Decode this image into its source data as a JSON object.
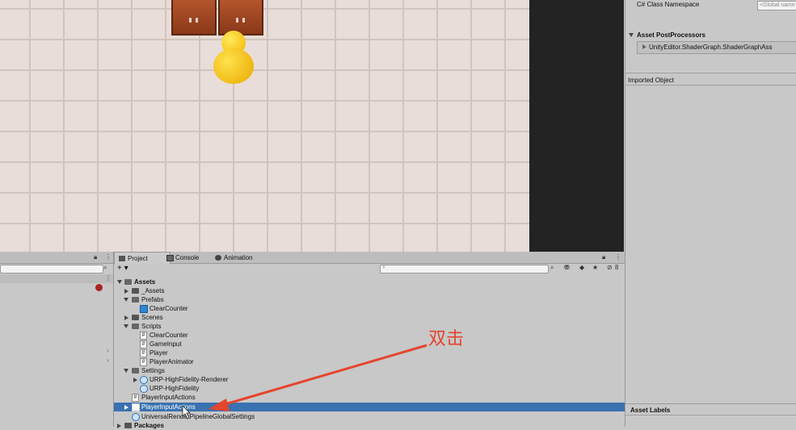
{
  "inspector": {
    "namespace_label": "C# Class Namespace",
    "namespace_placeholder": "<Global name",
    "postprocessors_header": "Asset PostProcessors",
    "postprocessor_item": "UnityEditor.ShaderGraph.ShaderGraphAss",
    "imported_object": "Imported Object",
    "asset_labels": "Asset Labels"
  },
  "project": {
    "tabs": [
      {
        "label": "Project"
      },
      {
        "label": "Console"
      },
      {
        "label": "Animation"
      }
    ],
    "add_label": "+ ▾",
    "hidden_count": "8",
    "tree": [
      {
        "label": "Assets"
      },
      {
        "label": "_Assets"
      },
      {
        "label": "Prefabs"
      },
      {
        "label": "ClearCounter"
      },
      {
        "label": "Scenes"
      },
      {
        "label": "Scripts"
      },
      {
        "label": "ClearCounter"
      },
      {
        "label": "GameInput"
      },
      {
        "label": "Player"
      },
      {
        "label": "PlayerAnimator"
      },
      {
        "label": "Settings"
      },
      {
        "label": "URP-HighFidelity-Renderer"
      },
      {
        "label": "URP-HighFidelity"
      },
      {
        "label": "PlayerInputActions"
      },
      {
        "label": "PlayerInputActions"
      },
      {
        "label": "UniversalRenderPipelineGlobalSettings"
      },
      {
        "label": "Packages"
      }
    ]
  },
  "annotation": {
    "text": "双击",
    "color": "#e6442d"
  },
  "colors": {
    "selection": "#3a72b0",
    "panel": "#c8c8c8",
    "scene_dark": "#232323"
  }
}
